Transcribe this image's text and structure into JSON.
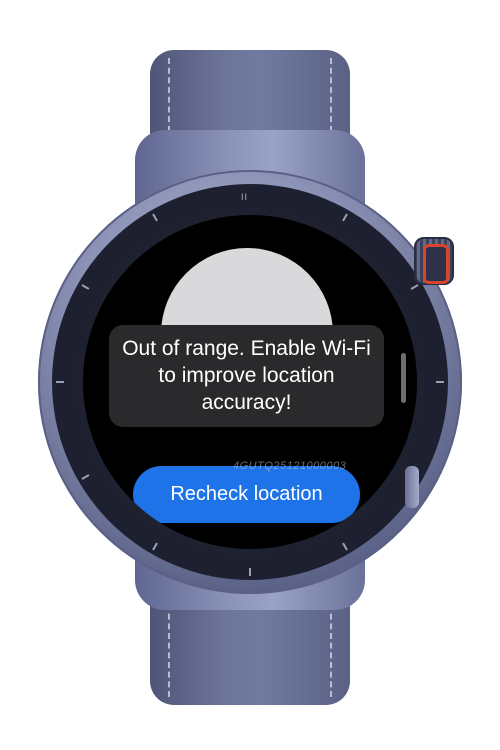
{
  "device": {
    "bezel_mark": "II",
    "crown_accent_color": "#d6452c",
    "strap_color": "#6b7397"
  },
  "screen": {
    "location_icon": "location-circle-icon",
    "toast": {
      "message": "Out of range. Enable Wi-Fi to improve location accuracy!"
    },
    "recheck_button": {
      "label": "Recheck location",
      "color": "#1f73e8"
    },
    "watermark": "4GUTQ25121000003"
  }
}
